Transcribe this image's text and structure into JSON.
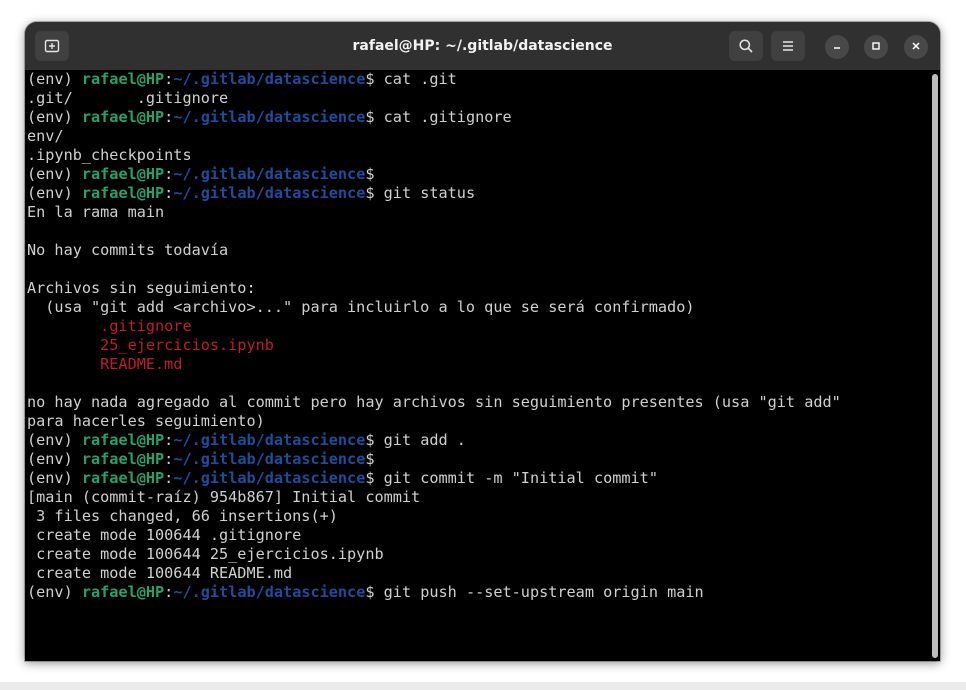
{
  "window": {
    "title": "rafael@HP: ~/.gitlab/datascience"
  },
  "colors": {
    "user_host": "#26a269",
    "path": "#1e4d9e",
    "untracked": "#c01c28",
    "text": "#d0d0d0",
    "background": "#000000"
  },
  "icons": {
    "new_tab": "new-tab-icon",
    "search": "search-icon",
    "menu": "hamburger-menu-icon",
    "minimize": "minimize-icon",
    "maximize": "maximize-icon",
    "close": "close-icon"
  },
  "prompt": {
    "env": "(env) ",
    "user_host": "rafael@HP",
    "colon": ":",
    "path": "~/.gitlab/datascience",
    "dollar": "$ "
  },
  "lines": [
    {
      "type": "prompt",
      "cmd": "cat .git"
    },
    {
      "type": "out",
      "text": ".git/       .gitignore"
    },
    {
      "type": "prompt",
      "cmd": "cat .gitignore"
    },
    {
      "type": "out",
      "text": "env/"
    },
    {
      "type": "out",
      "text": ".ipynb_checkpoints"
    },
    {
      "type": "prompt",
      "cmd": ""
    },
    {
      "type": "prompt",
      "cmd": "git status"
    },
    {
      "type": "out",
      "text": "En la rama main"
    },
    {
      "type": "out",
      "text": ""
    },
    {
      "type": "out",
      "text": "No hay commits todavía"
    },
    {
      "type": "out",
      "text": ""
    },
    {
      "type": "out",
      "text": "Archivos sin seguimiento:"
    },
    {
      "type": "out",
      "text": "  (usa \"git add <archivo>...\" para incluirlo a lo que se será confirmado)"
    },
    {
      "type": "untracked",
      "text": "\t.gitignore"
    },
    {
      "type": "untracked",
      "text": "\t25_ejercicios.ipynb"
    },
    {
      "type": "untracked",
      "text": "\tREADME.md"
    },
    {
      "type": "out",
      "text": ""
    },
    {
      "type": "out",
      "text": "no hay nada agregado al commit pero hay archivos sin seguimiento presentes (usa \"git add\""
    },
    {
      "type": "out",
      "text": "para hacerles seguimiento)"
    },
    {
      "type": "prompt",
      "cmd": "git add ."
    },
    {
      "type": "prompt",
      "cmd": ""
    },
    {
      "type": "prompt",
      "cmd": "git commit -m \"Initial commit\""
    },
    {
      "type": "out",
      "text": "[main (commit-raíz) 954b867] Initial commit"
    },
    {
      "type": "out",
      "text": " 3 files changed, 66 insertions(+)"
    },
    {
      "type": "out",
      "text": " create mode 100644 .gitignore"
    },
    {
      "type": "out",
      "text": " create mode 100644 25_ejercicios.ipynb"
    },
    {
      "type": "out",
      "text": " create mode 100644 README.md"
    },
    {
      "type": "prompt",
      "cmd": "git push --set-upstream origin main"
    }
  ]
}
